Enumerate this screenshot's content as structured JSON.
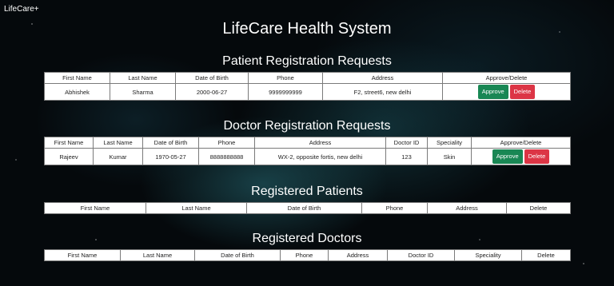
{
  "brand": "LifeCare+",
  "title": "LifeCare Health System",
  "patient_requests": {
    "heading": "Patient Registration Requests",
    "columns": [
      "First Name",
      "Last Name",
      "Date of Birth",
      "Phone",
      "Address",
      "Approve/Delete"
    ],
    "rows": [
      {
        "first_name": "Abhishek",
        "last_name": "Sharma",
        "dob": "2000-06-27",
        "phone": "9999999999",
        "address": "F2, street6, new delhi",
        "approve_label": "Approve",
        "delete_label": "Delete"
      }
    ]
  },
  "doctor_requests": {
    "heading": "Doctor Registration Requests",
    "columns": [
      "First Name",
      "Last Name",
      "Date of Birth",
      "Phone",
      "Address",
      "Doctor ID",
      "Speciality",
      "Approve/Delete"
    ],
    "rows": [
      {
        "first_name": "Rajeev",
        "last_name": "Kumar",
        "dob": "1970-05-27",
        "phone": "8888888888",
        "address": "WX-2, opposite fortis, new delhi",
        "doctor_id": "123",
        "speciality": "Skin",
        "approve_label": "Approve",
        "delete_label": "Delete"
      }
    ]
  },
  "registered_patients": {
    "heading": "Registered Patients",
    "columns": [
      "First Name",
      "Last Name",
      "Date of Birth",
      "Phone",
      "Address",
      "Delete"
    ]
  },
  "registered_doctors": {
    "heading": "Registered Doctors",
    "columns": [
      "First Name",
      "Last Name",
      "Date of Birth",
      "Phone",
      "Address",
      "Doctor ID",
      "Speciality",
      "Delete"
    ]
  },
  "colors": {
    "approve": "#198754",
    "delete": "#dc3545"
  }
}
